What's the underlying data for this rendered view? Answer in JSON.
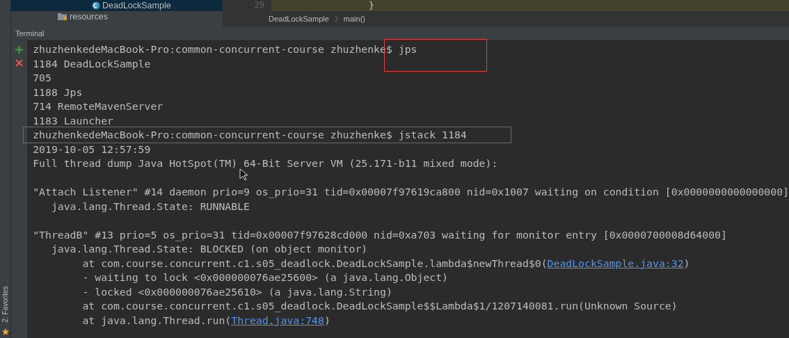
{
  "project_tree": {
    "items": [
      {
        "label": "DeadLockSample",
        "selected": true,
        "kind": "class"
      },
      {
        "label": "resources",
        "selected": false,
        "kind": "folder"
      }
    ]
  },
  "editor": {
    "line_number": "29",
    "code": "}",
    "breadcrumbs": [
      "DeadLockSample",
      "main()"
    ]
  },
  "terminal": {
    "title": "Terminal",
    "lines": [
      {
        "kind": "text",
        "text": "zhuzhenkedeMacBook-Pro:common-concurrent-course zhuzhenke$ jps"
      },
      {
        "kind": "text",
        "text": "1184 DeadLockSample"
      },
      {
        "kind": "text",
        "text": "705"
      },
      {
        "kind": "text",
        "text": "1188 Jps"
      },
      {
        "kind": "text",
        "text": "714 RemoteMavenServer"
      },
      {
        "kind": "text",
        "text": "1183 Launcher"
      },
      {
        "kind": "boxed",
        "text": "zhuzhenkedeMacBook-Pro:common-concurrent-course zhuzhenke$ jstack 1184"
      },
      {
        "kind": "text",
        "text": "2019-10-05 12:57:59"
      },
      {
        "kind": "text",
        "text": "Full thread dump Java HotSpot(TM) 64-Bit Server VM (25.171-b11 mixed mode):"
      },
      {
        "kind": "blank"
      },
      {
        "kind": "text",
        "text": "\"Attach Listener\" #14 daemon prio=9 os_prio=31 tid=0x00007f97619ca800 nid=0x1007 waiting on condition [0x0000000000000000]"
      },
      {
        "kind": "text",
        "text": "   java.lang.Thread.State: RUNNABLE"
      },
      {
        "kind": "blank"
      },
      {
        "kind": "text",
        "text": "\"ThreadB\" #13 prio=5 os_prio=31 tid=0x00007f97628cd000 nid=0xa703 waiting for monitor entry [0x0000700008d64000]"
      },
      {
        "kind": "text",
        "text": "   java.lang.Thread.State: BLOCKED (on object monitor)"
      },
      {
        "kind": "link",
        "text": "        at com.course.concurrent.c1.s05_deadlock.DeadLockSample.lambda$newThread$0(",
        "link": "DeadLockSample.java:32",
        "after": ")"
      },
      {
        "kind": "text",
        "text": "        - waiting to lock <0x000000076ae25600> (a java.lang.Object)"
      },
      {
        "kind": "text",
        "text": "        - locked <0x000000076ae25610> (a java.lang.String)"
      },
      {
        "kind": "text",
        "text": "        at com.course.concurrent.c1.s05_deadlock.DeadLockSample$$Lambda$1/1207140081.run(Unknown Source)"
      },
      {
        "kind": "link",
        "text": "        at java.lang.Thread.run(",
        "link": "Thread.java:748",
        "after": ")"
      }
    ]
  },
  "side_bar": {
    "label": "2: Favorites"
  }
}
